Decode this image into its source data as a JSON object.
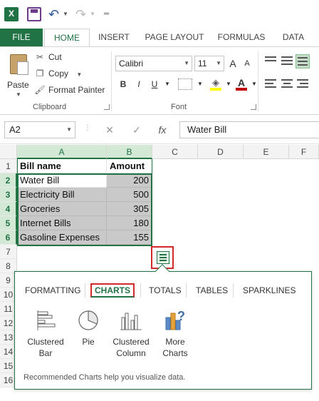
{
  "quick_access": {
    "app_icon": "excel-icon",
    "items": [
      "save-icon",
      "undo-icon",
      "redo-icon",
      "customize-icon"
    ]
  },
  "tabs": [
    "FILE",
    "HOME",
    "INSERT",
    "PAGE LAYOUT",
    "FORMULAS",
    "DATA"
  ],
  "ribbon": {
    "clipboard": {
      "paste": "Paste",
      "cut": "Cut",
      "copy": "Copy",
      "format_painter": "Format Painter",
      "label": "Clipboard"
    },
    "font": {
      "font_name": "Calibri",
      "font_size": "11",
      "bold": "B",
      "italic": "I",
      "underline": "U",
      "grow": "A",
      "shrink": "A",
      "font_color_letter": "A",
      "label": "Font",
      "font_color": "#c00000",
      "fill_color": "#ffff00"
    }
  },
  "formula_bar": {
    "name_box": "A2",
    "cancel": "✕",
    "enter": "✓",
    "fx": "fx",
    "value": "Water Bill"
  },
  "grid": {
    "columns": [
      "A",
      "B",
      "C",
      "D",
      "E",
      "F"
    ],
    "rows": [
      "1",
      "2",
      "3",
      "4",
      "5",
      "6",
      "7",
      "8",
      "9",
      "10",
      "11",
      "12",
      "13",
      "14",
      "15",
      "16"
    ],
    "header": [
      "Bill name",
      "Amount"
    ],
    "data": [
      [
        "Water Bill",
        "200"
      ],
      [
        "Electricity Bill",
        "500"
      ],
      [
        "Groceries",
        "305"
      ],
      [
        "Internet Bills",
        "180"
      ],
      [
        "Gasoline Expenses",
        "155"
      ]
    ]
  },
  "quick_analysis": {
    "tabs": [
      "FORMATTING",
      "CHARTS",
      "TOTALS",
      "TABLES",
      "SPARKLINES"
    ],
    "active_tab": "CHARTS",
    "items": [
      {
        "line1": "Clustered",
        "line2": "Bar",
        "icon": "clustered-bar-chart-icon"
      },
      {
        "line1": "Pie",
        "line2": "",
        "icon": "pie-chart-icon"
      },
      {
        "line1": "Clustered",
        "line2": "Column",
        "icon": "clustered-column-chart-icon"
      },
      {
        "line1": "More",
        "line2": "Charts",
        "icon": "more-charts-icon"
      }
    ],
    "hint": "Recommended Charts help you visualize data."
  },
  "colors": {
    "accent": "#217346",
    "highlight": "#d02a2a",
    "selection_fill": "#c9c9c9"
  }
}
